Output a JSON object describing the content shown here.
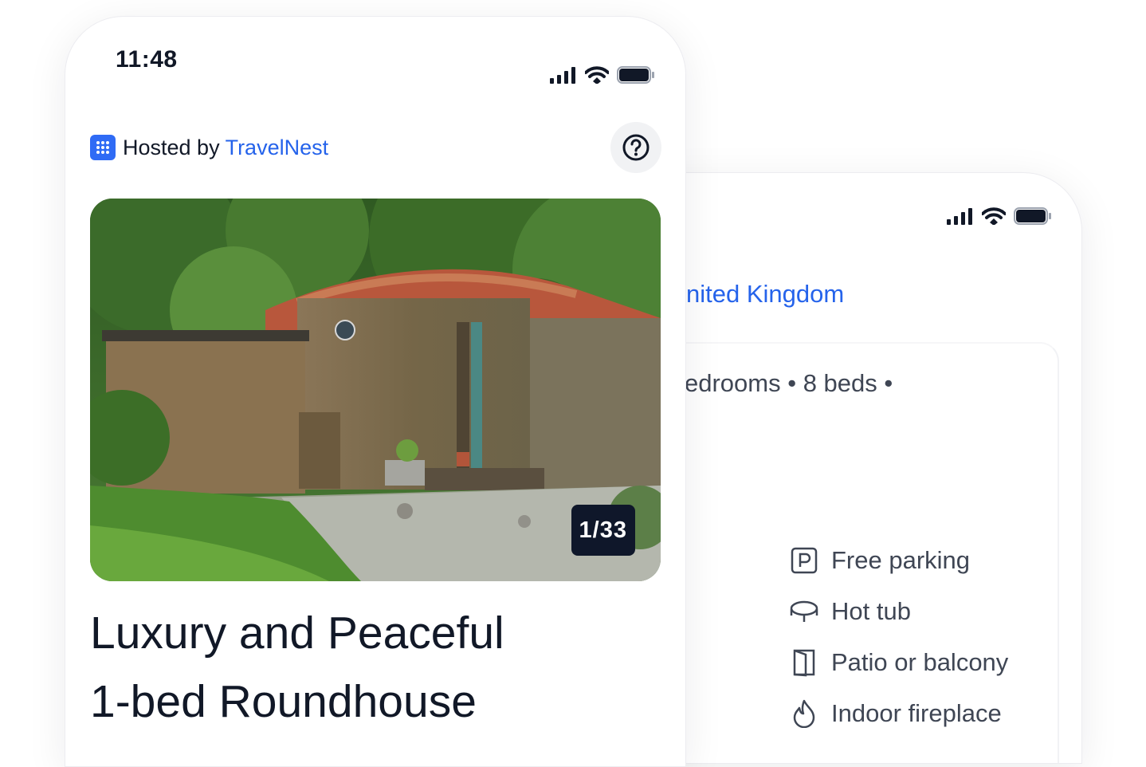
{
  "front_phone": {
    "status_time": "11:48",
    "host_label": "Hosted by",
    "host_name": "TravelNest",
    "photo_counter": "1/33",
    "title_line1": "Luxury and Peaceful",
    "title_line2": "1-bed Roundhouse",
    "icons": {
      "signal": "signal-icon",
      "wifi": "wifi-icon",
      "battery": "battery-icon",
      "host_logo": "travelnest-logo-icon",
      "help": "question-circle-icon"
    }
  },
  "back_phone": {
    "location_text": "nited Kingdom",
    "specs_text": "edrooms • 8 beds •",
    "amenities": [
      {
        "label": "Free parking",
        "icon": "parking-icon"
      },
      {
        "label": "Hot tub",
        "icon": "hot-tub-icon"
      },
      {
        "label": "Patio or balcony",
        "icon": "door-icon"
      },
      {
        "label": "Indoor fireplace",
        "icon": "flame-icon"
      }
    ]
  },
  "colors": {
    "link_blue": "#2563eb",
    "logo_blue": "#2f6bf5",
    "text_dark": "#111827",
    "text_gray": "#3f4654",
    "counter_bg": "#0f172a"
  }
}
